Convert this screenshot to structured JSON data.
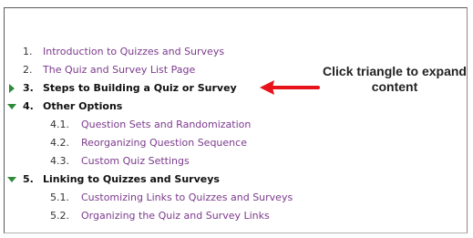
{
  "toc": {
    "items": [
      {
        "num": "1.",
        "label": "Introduction to Quizzes and Surveys"
      },
      {
        "num": "2.",
        "label": "The Quiz and Survey List Page"
      },
      {
        "num": "3.",
        "label": "Steps to Building a Quiz or Survey",
        "expander": "triangle-right-icon"
      },
      {
        "num": "4.",
        "label": "Other Options",
        "expander": "triangle-down-icon",
        "children": [
          {
            "num": "4.1.",
            "label": "Question Sets and Randomization"
          },
          {
            "num": "4.2.",
            "label": "Reorganizing Question Sequence"
          },
          {
            "num": "4.3.",
            "label": "Custom Quiz Settings"
          }
        ]
      },
      {
        "num": "5.",
        "label": "Linking to Quizzes and Surveys",
        "expander": "triangle-down-icon",
        "children": [
          {
            "num": "5.1.",
            "label": "Customizing Links to Quizzes and Surveys"
          },
          {
            "num": "5.2.",
            "label": "Organizing the Quiz and Survey Links"
          }
        ]
      }
    ]
  },
  "callout": {
    "line1": "Click triangle to expand",
    "line2": "content",
    "arrow_color": "#e8121a"
  },
  "colors": {
    "link": "#7b3a8c",
    "triangle": "#2e8b3a",
    "text": "#111111"
  }
}
